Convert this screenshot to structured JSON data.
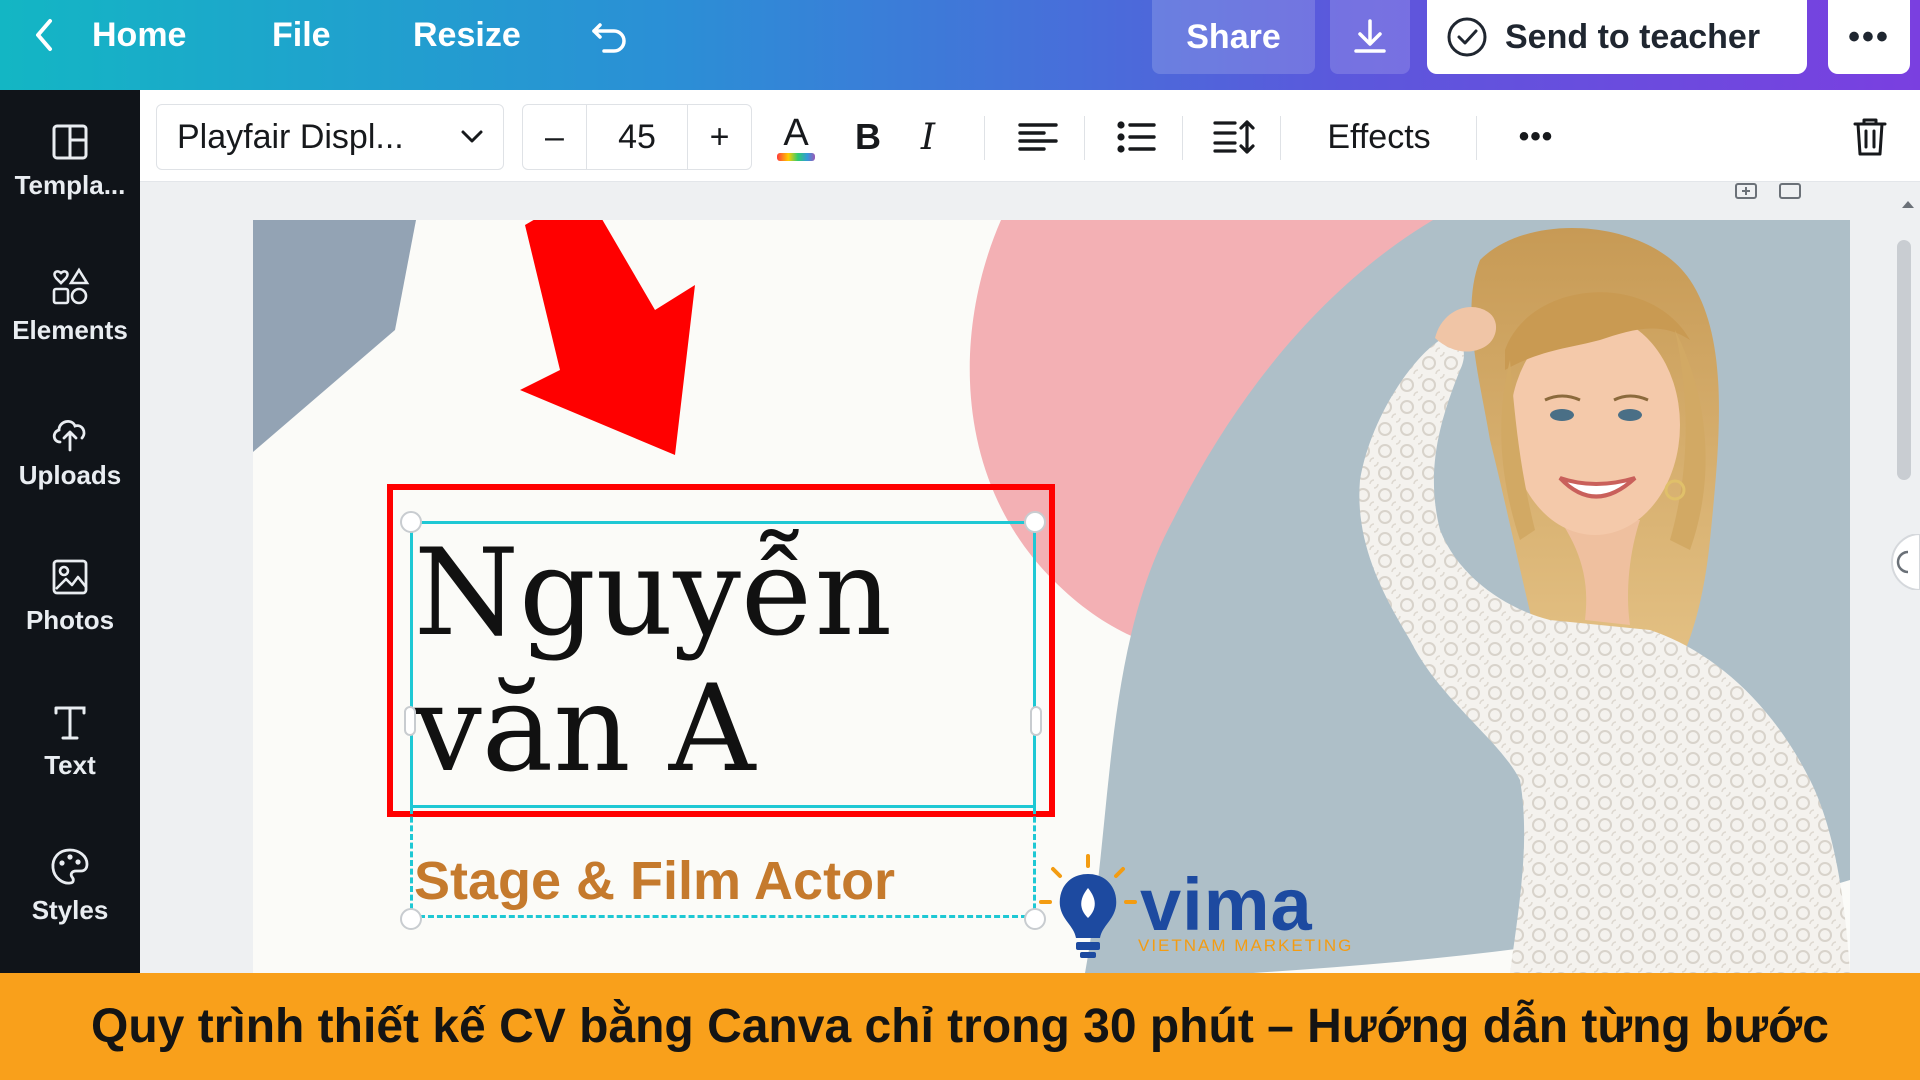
{
  "topbar": {
    "home_label": "Home",
    "file_label": "File",
    "resize_label": "Resize",
    "share_label": "Share",
    "send_label": "Send to teacher",
    "more_label": "•••",
    "icons": [
      "back-icon",
      "undo-icon",
      "download-icon",
      "check-circle-icon"
    ]
  },
  "sidebar": {
    "items": [
      {
        "label": "Templa...",
        "icon": "templates-icon"
      },
      {
        "label": "Elements",
        "icon": "elements-icon"
      },
      {
        "label": "Uploads",
        "icon": "upload-icon"
      },
      {
        "label": "Photos",
        "icon": "photos-icon"
      },
      {
        "label": "Text",
        "icon": "text-icon"
      },
      {
        "label": "Styles",
        "icon": "styles-icon"
      }
    ]
  },
  "toolbar": {
    "font_name": "Playfair Displ...",
    "size_minus": "–",
    "font_size": "45",
    "size_plus": "+",
    "text_color_glyph": "A",
    "bold_glyph": "B",
    "italic_glyph": "I",
    "effects_label": "Effects",
    "more_label": "•••"
  },
  "canvas": {
    "name_line1": "Nguyễn",
    "name_line2": "văn A",
    "subtitle": "Stage & Film Actor",
    "logo_word": "vima",
    "logo_tagline": "VIETNAM MARKETING",
    "colors": {
      "accent_red": "#ff0000",
      "selection_cyan": "#1ec8d4",
      "subtitle_orange": "#c57a2d",
      "blob_pink": "#f3b0b4",
      "blob_blue": "#aebfc8"
    }
  },
  "caption": "Quy trình thiết kế CV bằng Canva chỉ trong 30 phút – Hướng dẫn từng bước"
}
